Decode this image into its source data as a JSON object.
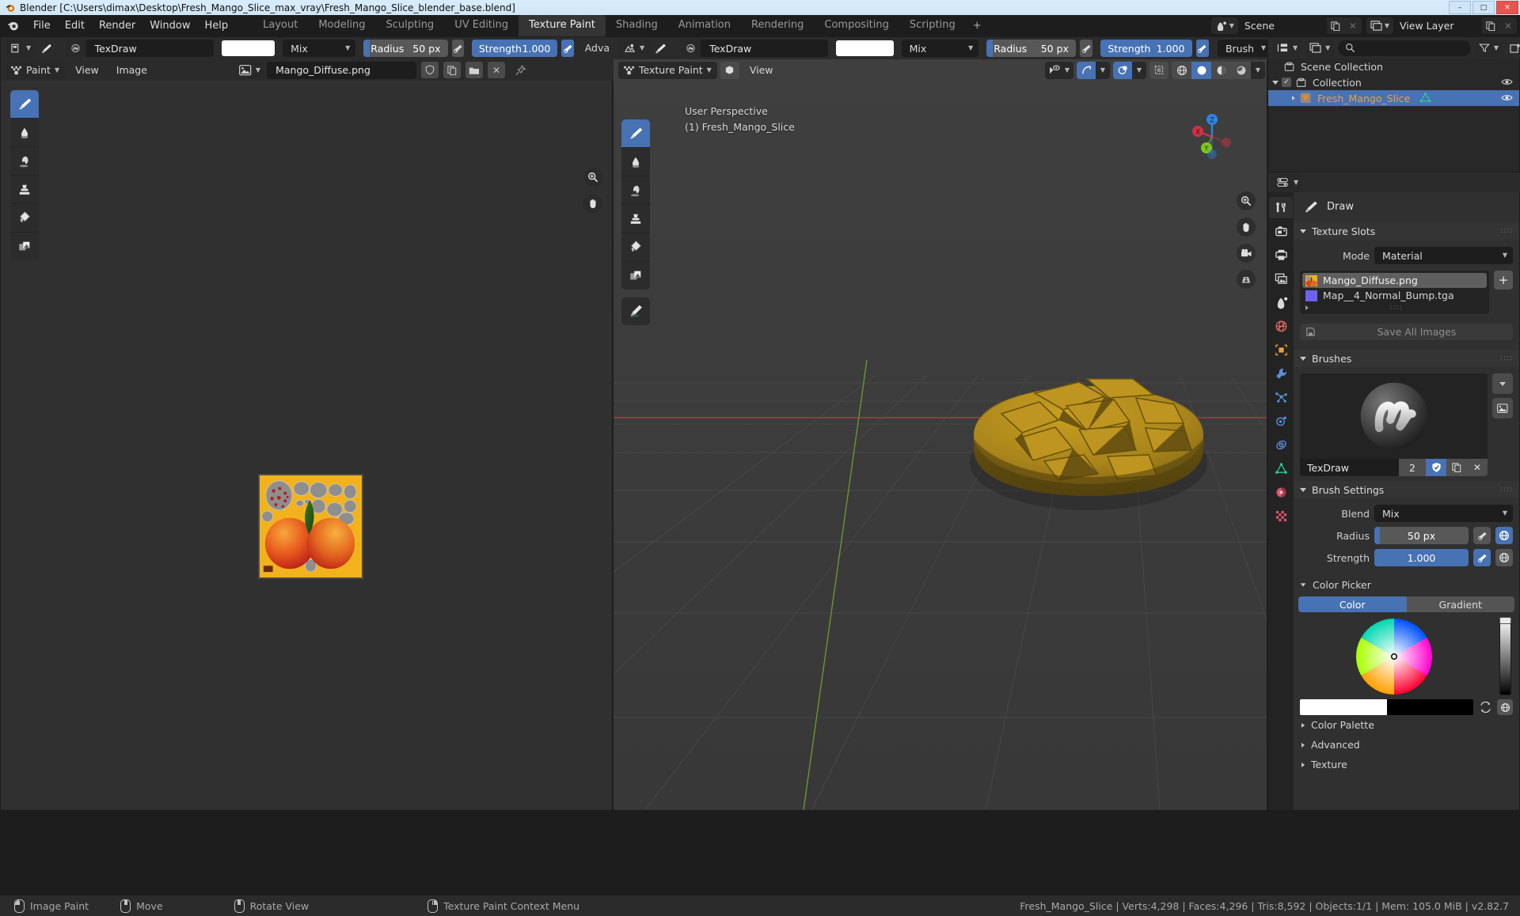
{
  "window": {
    "title": "Blender [C:\\Users\\dimax\\Desktop\\Fresh_Mango_Slice_max_vray\\Fresh_Mango_Slice_blender_base.blend]",
    "minimize": "–",
    "maximize": "□",
    "close": "✕"
  },
  "topbar": {
    "menus": [
      "File",
      "Edit",
      "Render",
      "Window",
      "Help"
    ],
    "workspaces": [
      {
        "label": "Layout",
        "active": false
      },
      {
        "label": "Modeling",
        "active": false
      },
      {
        "label": "Sculpting",
        "active": false
      },
      {
        "label": "UV Editing",
        "active": false
      },
      {
        "label": "Texture Paint",
        "active": true
      },
      {
        "label": "Shading",
        "active": false
      },
      {
        "label": "Animation",
        "active": false
      },
      {
        "label": "Rendering",
        "active": false
      },
      {
        "label": "Compositing",
        "active": false
      },
      {
        "label": "Scripting",
        "active": false
      },
      {
        "label": "+",
        "active": false
      }
    ],
    "scene_name": "Scene",
    "view_layer_name": "View Layer",
    "new_scene_icon": "duplicate-icon",
    "remove_scene_icon": "x-icon"
  },
  "image_editor": {
    "brush_preset_icon": "brush-preset-icon",
    "brush_icon": "brush-icon",
    "brush_name": "TexDraw",
    "color_hex": "#ffffff",
    "blend_mode": "Mix",
    "radius_label": "Radius",
    "radius_value": "50 px",
    "strength_label": "Strength",
    "strength_value": "1.000",
    "advanced_label": "Adva",
    "mode": "Paint",
    "menus": [
      "View",
      "Image"
    ],
    "image_name": "Mango_Diffuse.png",
    "tools": [
      {
        "name": "tool-draw",
        "icon": "brush-icon",
        "active": true
      },
      {
        "name": "tool-soften",
        "icon": "droplet-icon",
        "active": false
      },
      {
        "name": "tool-smear",
        "icon": "smear-icon",
        "active": false
      },
      {
        "name": "tool-clone",
        "icon": "stamp-icon",
        "active": false
      },
      {
        "name": "tool-fill",
        "icon": "bucket-icon",
        "active": false
      },
      {
        "name": "tool-mask",
        "icon": "mask-icon",
        "active": false
      }
    ],
    "nav_icons": [
      "zoom-icon",
      "hand-icon"
    ]
  },
  "viewport": {
    "brush_preset_icon": "brush-preset-icon",
    "brush_icon": "brush-icon",
    "brush_name": "TexDraw",
    "color_hex": "#ffffff",
    "blend_mode": "Mix",
    "radius_label": "Radius",
    "radius_value": "50 px",
    "strength_label": "Strength",
    "strength_value": "1.000",
    "falloff_label": "Brush",
    "mode": "Texture Paint",
    "menus": [
      "View"
    ],
    "overlay_line1": "User Perspective",
    "overlay_line2": "(1) Fresh_Mango_Slice",
    "tools": [
      {
        "name": "tool-draw",
        "icon": "brush-icon",
        "active": true
      },
      {
        "name": "tool-soften",
        "icon": "droplet-icon",
        "active": false
      },
      {
        "name": "tool-smear",
        "icon": "smear-icon",
        "active": false
      },
      {
        "name": "tool-clone",
        "icon": "stamp-icon",
        "active": false
      },
      {
        "name": "tool-fill",
        "icon": "bucket-icon",
        "active": false
      },
      {
        "name": "tool-mask",
        "icon": "mask-icon",
        "active": false
      },
      {
        "name": "tool-annotate",
        "icon": "annotate-icon",
        "active": false
      }
    ],
    "shading_modes": [
      {
        "name": "wireframe",
        "active": false
      },
      {
        "name": "solid",
        "active": true
      },
      {
        "name": "material-preview",
        "active": false
      },
      {
        "name": "rendered",
        "active": false
      }
    ],
    "gizmo_axes": [
      {
        "label": "Z",
        "color": "#2f83e3"
      },
      {
        "label": "Y",
        "color": "#7fc61a"
      },
      {
        "label": "X",
        "color": "#cc3344"
      }
    ],
    "nav_icons": [
      "zoom-icon",
      "hand-icon",
      "camera-icon",
      "ortho-persp-icon"
    ]
  },
  "outliner": {
    "display_mode_icon": "view-layer-icon",
    "filter_icon": "filter-icon",
    "new_collection_icon": "new-collection-icon",
    "search_placeholder": "",
    "rows": [
      {
        "label": "Scene Collection",
        "indent": 0,
        "icon": "collection-icon",
        "selected": false,
        "has_disclosure": false,
        "has_checkbox": false,
        "has_eye": false,
        "color": "#d3d3d3"
      },
      {
        "label": "Collection",
        "indent": 1,
        "icon": "collection-icon",
        "selected": false,
        "has_disclosure": true,
        "has_checkbox": true,
        "has_eye": true,
        "color": "#d3d3d3"
      },
      {
        "label": "Fresh_Mango_Slice",
        "indent": 2,
        "icon": "object-mesh-icon",
        "selected": true,
        "has_disclosure": true,
        "has_checkbox": false,
        "has_eye": true,
        "color": "#e8a33d"
      }
    ]
  },
  "properties": {
    "editor_type_icon": "properties-icon",
    "tabs": [
      {
        "name": "tool",
        "icon": "tool-icon",
        "active": true,
        "color": "#d9d9d9"
      },
      {
        "name": "render",
        "icon": "camera-back-icon",
        "active": false,
        "color": "#d9d9d9"
      },
      {
        "name": "output",
        "icon": "printer-icon",
        "active": false,
        "color": "#d9d9d9"
      },
      {
        "name": "view-layer",
        "icon": "images-icon",
        "active": false,
        "color": "#d9d9d9"
      },
      {
        "name": "scene",
        "icon": "scene-icon",
        "active": false,
        "color": "#d9d9d9"
      },
      {
        "name": "world",
        "icon": "world-icon",
        "active": false,
        "color": "#d9665f"
      },
      {
        "name": "object",
        "icon": "object-icon",
        "active": false,
        "color": "#e8a33d"
      },
      {
        "name": "modifiers",
        "icon": "wrench-icon",
        "active": false,
        "color": "#5b8fd8"
      },
      {
        "name": "particles",
        "icon": "particles-icon",
        "active": false,
        "color": "#5b8fd8"
      },
      {
        "name": "physics",
        "icon": "physics-icon",
        "active": false,
        "color": "#5b8fd8"
      },
      {
        "name": "constraints",
        "icon": "constraints-icon",
        "active": false,
        "color": "#5b8fd8"
      },
      {
        "name": "data",
        "icon": "mesh-data-icon",
        "active": false,
        "color": "#2fc99a"
      },
      {
        "name": "material",
        "icon": "material-icon",
        "active": false,
        "color": "#d9546a"
      },
      {
        "name": "texture",
        "icon": "texture-icon",
        "active": false,
        "color": "#d9546a"
      }
    ],
    "breadcrumb_icon": "brush-icon",
    "breadcrumb_label": "Draw",
    "texture_slots": {
      "title": "Texture Slots",
      "mode_label": "Mode",
      "mode_value": "Material",
      "add_label": "+",
      "slots": [
        {
          "label": "Mango_Diffuse.png",
          "selected": true,
          "swatch": "texture-thumb"
        },
        {
          "label": "Map__4_Normal_Bump.tga",
          "selected": false,
          "swatch": "#6b63f0"
        }
      ],
      "save_all_label": "Save All Images",
      "save_icon": "save-icon"
    },
    "brushes": {
      "title": "Brushes",
      "preview_icon": "brush-stroke-preview",
      "brush_name": "TexDraw",
      "users_count": "2",
      "fake_user_icon": "shield-check-icon",
      "duplicate_icon": "duplicate-icon",
      "unlink_icon": "x-icon",
      "browse_icon": "chevron-down-icon",
      "preview_toggle_icon": "image-icon"
    },
    "brush_settings": {
      "title": "Brush Settings",
      "blend_label": "Blend",
      "blend_value": "Mix",
      "radius_label": "Radius",
      "radius_value": "50 px",
      "radius_fill_pct": 6,
      "strength_label": "Strength",
      "strength_value": "1.000",
      "strength_fill_pct": 100,
      "pressure_icon": "pressure-icon",
      "unified_icon": "globe-icon"
    },
    "color_picker": {
      "title": "Color Picker",
      "tabs": [
        {
          "label": "Color",
          "active": true
        },
        {
          "label": "Gradient",
          "active": false
        }
      ],
      "primary_color": "#ffffff",
      "secondary_color": "#000000",
      "swap_icon": "swap-icon",
      "unified_icon": "globe-icon"
    },
    "collapsed_panels": [
      "Color Palette",
      "Advanced",
      "Texture"
    ]
  },
  "statusbar": {
    "hints": [
      {
        "mouse": "lmb",
        "label": "Image Paint"
      },
      {
        "mouse": "mmb",
        "label": "Move"
      },
      {
        "mouse": "mmb",
        "label": "Rotate View"
      },
      {
        "mouse": "rmb",
        "label": "Texture Paint Context Menu"
      }
    ],
    "stats": "Fresh_Mango_Slice | Verts:4,298 | Faces:4,296 | Tris:8,592 | Objects:1/1 | Mem: 105.0 MiB | v2.82.7"
  }
}
